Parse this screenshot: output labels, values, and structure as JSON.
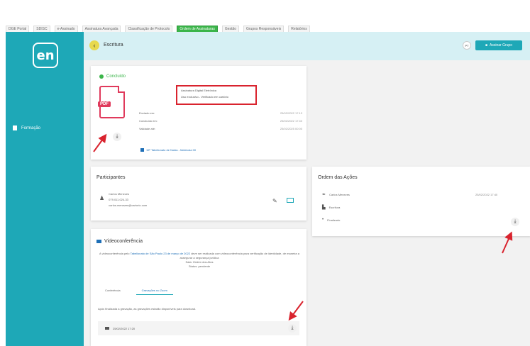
{
  "tabs": [
    "DGE Portal",
    "SDISC",
    "e-Assinado",
    "Assinatura Avançada",
    "Classificação de Protocolo",
    "Ordem de Assinaturas",
    "Gestão",
    "Grupos Responsáveis",
    "Relatórios"
  ],
  "tabs_active_index": 5,
  "sidebar": {
    "logo": "en",
    "nav": [
      {
        "label": "Formação",
        "icon": "document-icon"
      }
    ]
  },
  "header": {
    "back_icon": "back-arrow-icon",
    "title": "Escritura",
    "user_initials": "PT",
    "user_button": "Assinar Grupo"
  },
  "document": {
    "status": "Concluído",
    "file_type": "PDF",
    "signature": {
      "line1": "Assinatura Digital Eletrônica",
      "line2": "Uso exclusivo - Verificado em cartório"
    },
    "info": [
      {
        "label": "Enviado em:",
        "value": "25/02/2022 17:13"
      },
      {
        "label": "Concluído em:",
        "value": "25/02/2022 17:40"
      },
      {
        "label": "Validade até:",
        "value": "25/02/2025 00:00"
      }
    ],
    "link": "15º Tabelionato de Notas - Matrícula 00"
  },
  "participants": {
    "title": "Participantes",
    "person": {
      "name": "Carlos Menezes",
      "doc": "079.011.024-33",
      "email": "carlos.menezes@cartorio.com"
    }
  },
  "video": {
    "title": "Videoconferência",
    "text_before": "A videoconferência pelo",
    "text_link": "Tabelionato de São Paulo 23 de março de 2022",
    "text_after": "deve ser realizada com videoconferência para verificação de identidade, de maneira a assegurar a segurança jurídica",
    "line2": "Sala: Ordem dos Atos",
    "line3": "Status: pendente",
    "tabs": [
      "Conferência",
      "Gravações no Zoom"
    ],
    "active_tab": 1,
    "note": "Após finalizada a gravação, as gravações estarão disponíveis para download.",
    "recording": "25/02/2022 17:20"
  },
  "actions": {
    "title": "Ordem das Ações",
    "items": [
      {
        "label": "Carlos Menezes",
        "icon": "pen-icon"
      },
      {
        "label": "Escritura",
        "icon": "document-icon"
      },
      {
        "label": "Finalizado",
        "icon": "dot-icon"
      }
    ],
    "date": "25/02/2022 17:40"
  },
  "colors": {
    "sidebar": "#1ea8b7",
    "header": "#d6f0f4",
    "status_green": "#3bb54a",
    "pdf_red": "#e03a5c",
    "arrow_red": "#d9232e"
  }
}
